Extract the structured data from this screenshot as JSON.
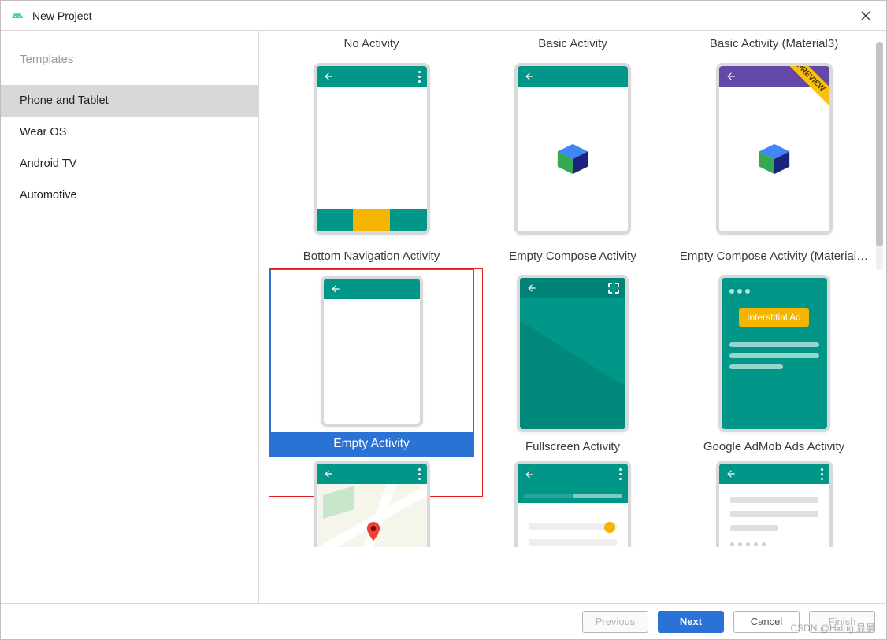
{
  "window": {
    "title": "New Project",
    "close_tooltip": "Close"
  },
  "sidebar": {
    "heading": "Templates",
    "categories": [
      {
        "label": "Phone and Tablet",
        "selected": true
      },
      {
        "label": "Wear OS"
      },
      {
        "label": "Android TV"
      },
      {
        "label": "Automotive"
      }
    ]
  },
  "templates": [
    {
      "id": "no-activity",
      "label": "No Activity"
    },
    {
      "id": "basic-activity",
      "label": "Basic Activity"
    },
    {
      "id": "basic-activity-m3",
      "label": "Basic Activity (Material3)",
      "preview_tag": "PREVIEW"
    },
    {
      "id": "bottom-nav-activity",
      "label": "Bottom Navigation Activity"
    },
    {
      "id": "empty-compose",
      "label": "Empty Compose Activity"
    },
    {
      "id": "empty-compose-m3",
      "label": "Empty Compose Activity (Material…"
    },
    {
      "id": "empty-activity",
      "label": "Empty Activity",
      "selected": true
    },
    {
      "id": "fullscreen-activity",
      "label": "Fullscreen Activity"
    },
    {
      "id": "admob-activity",
      "label": "Google AdMob Ads Activity",
      "ad_label": "Interstitial Ad"
    },
    {
      "id": "maps-activity",
      "label": ""
    },
    {
      "id": "login-activity",
      "label": ""
    },
    {
      "id": "primary-detail-activity",
      "label": ""
    }
  ],
  "buttons": {
    "previous": "Previous",
    "next": "Next",
    "cancel": "Cancel",
    "finish": "Finish"
  },
  "watermark": "CSDN @Hxiug.显晨"
}
